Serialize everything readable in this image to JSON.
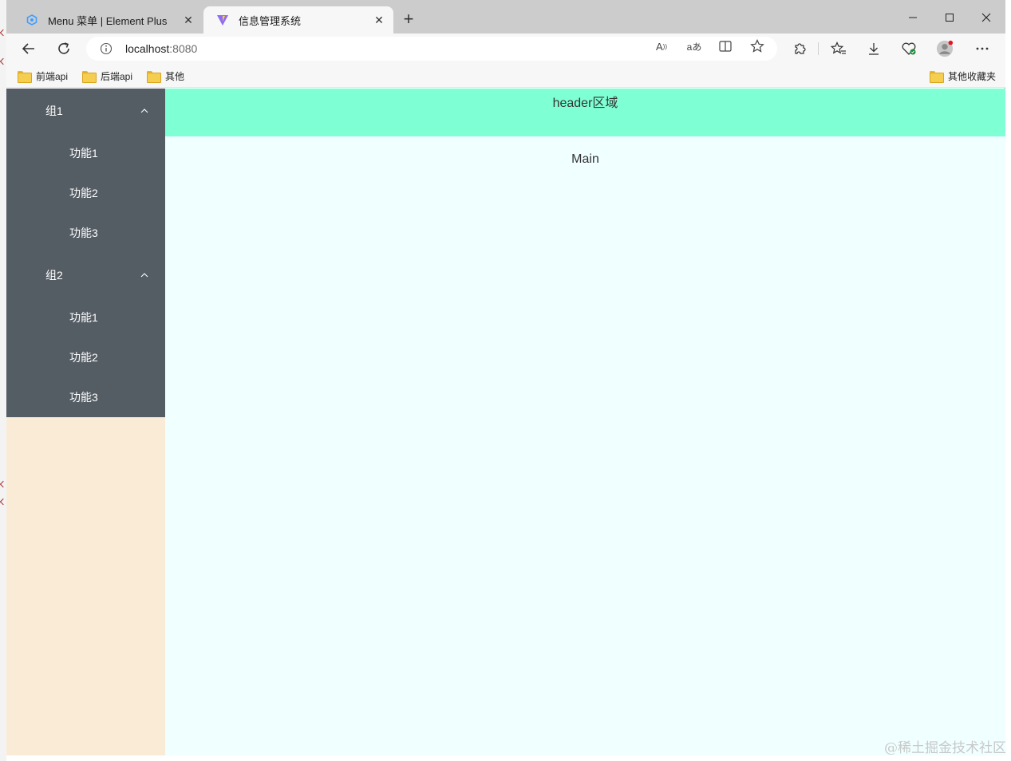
{
  "browser": {
    "tabs": [
      {
        "title": "Menu 菜单 | Element Plus",
        "favicon": "element-plus-icon",
        "active": false
      },
      {
        "title": "信息管理系统",
        "favicon": "vite-icon",
        "active": true
      }
    ],
    "address": {
      "host": "localhost",
      "port": ":8080"
    },
    "bookmarks": [
      {
        "label": "前端api"
      },
      {
        "label": "后端api"
      },
      {
        "label": "其他"
      }
    ],
    "other_bookmarks": "其他收藏夹",
    "read_aloud_label": "A",
    "translate_label": "aあ"
  },
  "sidebar": {
    "groups": [
      {
        "title": "组1",
        "items": [
          {
            "label": "功能1"
          },
          {
            "label": "功能2"
          },
          {
            "label": "功能3"
          }
        ]
      },
      {
        "title": "组2",
        "items": [
          {
            "label": "功能1"
          },
          {
            "label": "功能2"
          },
          {
            "label": "功能3"
          }
        ]
      }
    ]
  },
  "header": {
    "text": "header区域"
  },
  "main": {
    "text": "Main"
  },
  "watermark": "@稀土掘金技术社区",
  "colors": {
    "menu_bg": "#545c64",
    "aside_bg": "#faebd7",
    "header_bg": "#7fffd4",
    "main_bg": "#f0ffff"
  }
}
